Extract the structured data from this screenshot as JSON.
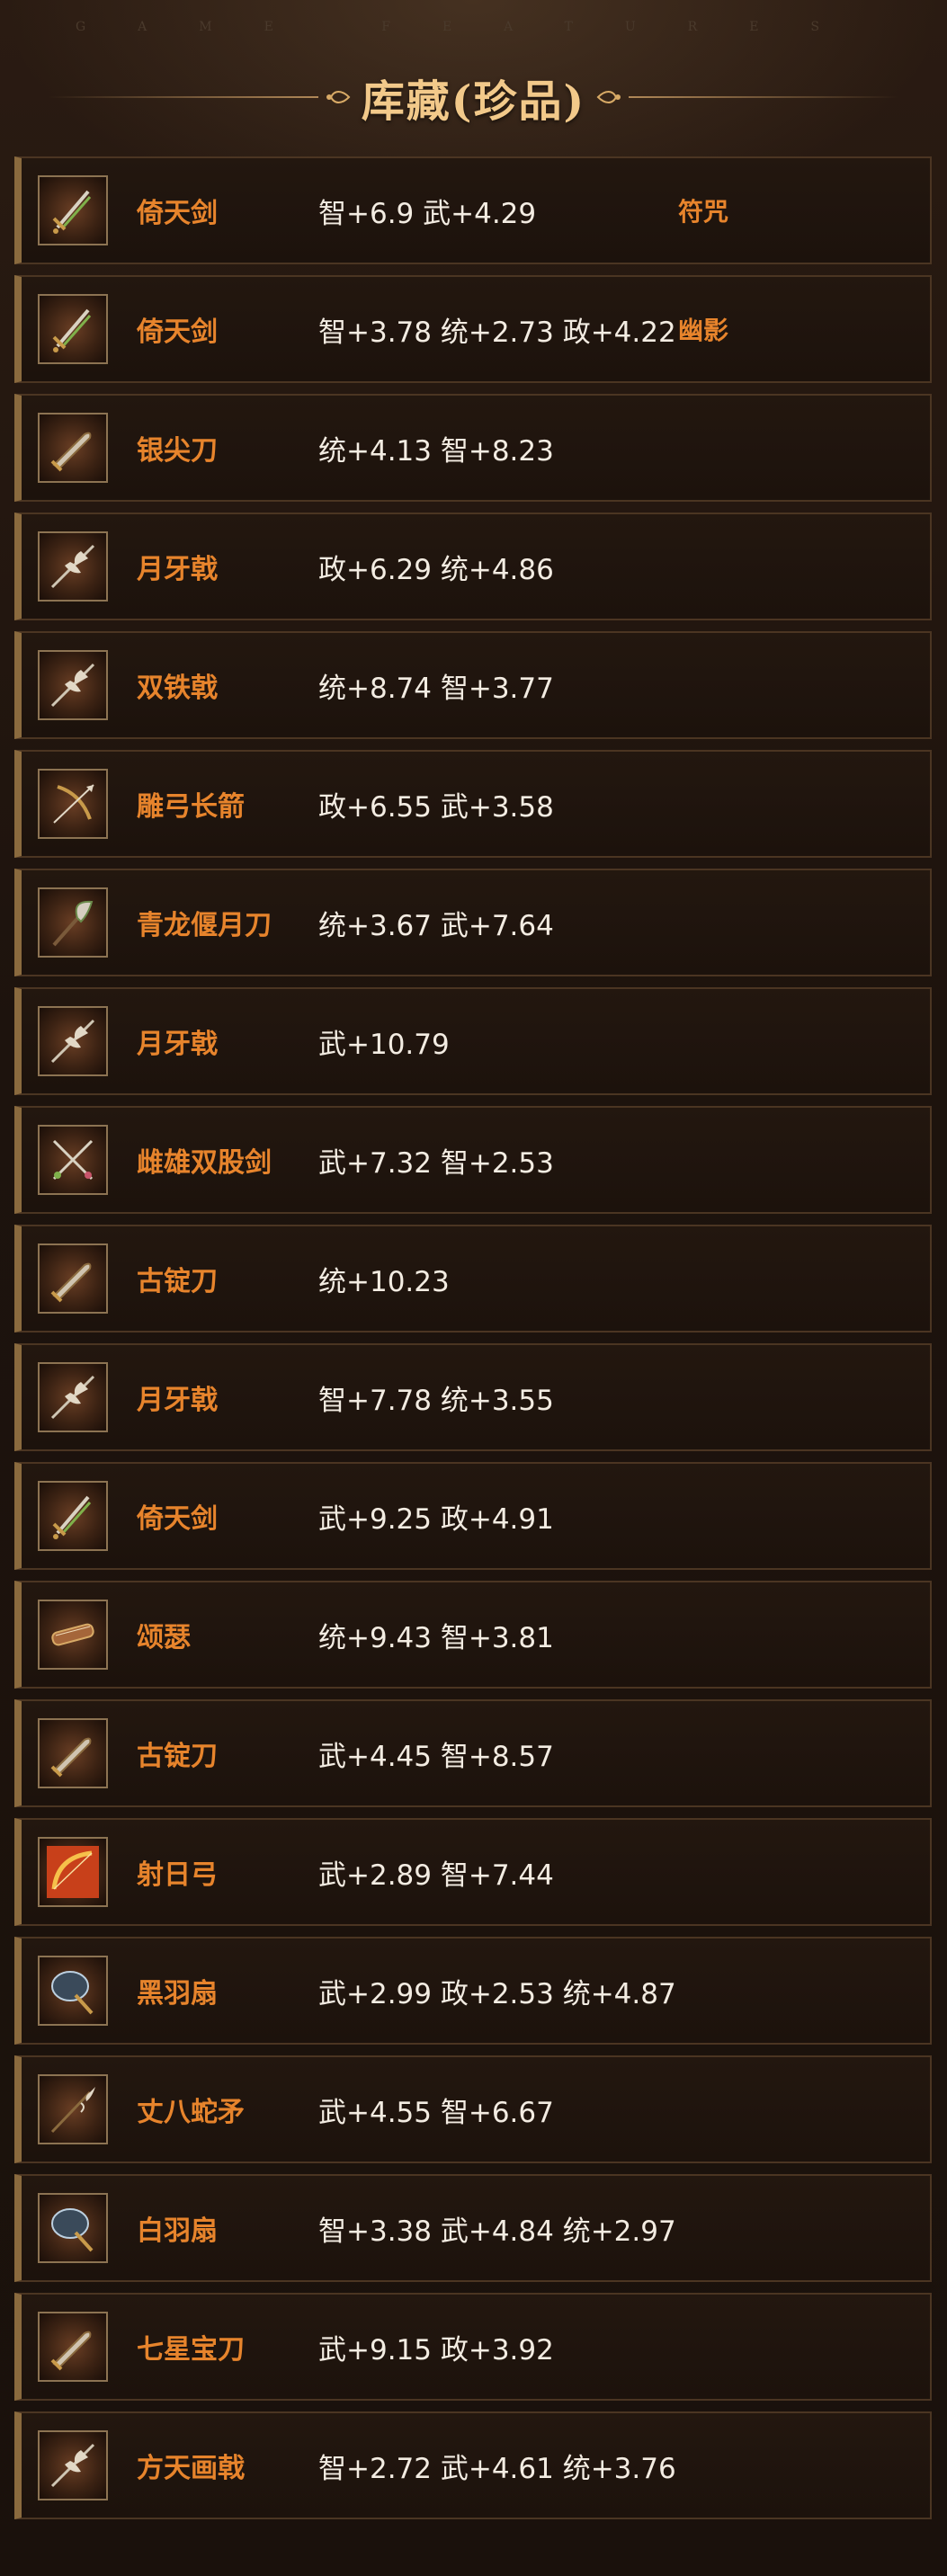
{
  "header": {
    "features_text": "GAME FEATURES",
    "title": "库藏(珍品)"
  },
  "items": [
    {
      "name": "倚天剑",
      "stats": "智+6.9 武+4.29",
      "tag": "符咒",
      "icon": "sword-icon"
    },
    {
      "name": "倚天剑",
      "stats": "智+3.78 统+2.73 政+4.22",
      "tag": "幽影",
      "icon": "sword-icon"
    },
    {
      "name": "银尖刀",
      "stats": "统+4.13 智+8.23",
      "tag": "",
      "icon": "blade-icon"
    },
    {
      "name": "月牙戟",
      "stats": "政+6.29 统+4.86",
      "tag": "",
      "icon": "halberd-icon"
    },
    {
      "name": "双铁戟",
      "stats": "统+8.74 智+3.77",
      "tag": "",
      "icon": "halberd-icon"
    },
    {
      "name": "雕弓长箭",
      "stats": "政+6.55 武+3.58",
      "tag": "",
      "icon": "bow-arrow-icon"
    },
    {
      "name": "青龙偃月刀",
      "stats": "统+3.67 武+7.64",
      "tag": "",
      "icon": "glaive-icon"
    },
    {
      "name": "月牙戟",
      "stats": "武+10.79",
      "tag": "",
      "icon": "halberd-icon"
    },
    {
      "name": "雌雄双股剑",
      "stats": "武+7.32 智+2.53",
      "tag": "",
      "icon": "twin-swords-icon"
    },
    {
      "name": "古锭刀",
      "stats": "统+10.23",
      "tag": "",
      "icon": "blade-icon"
    },
    {
      "name": "月牙戟",
      "stats": "智+7.78 统+3.55",
      "tag": "",
      "icon": "halberd-icon"
    },
    {
      "name": "倚天剑",
      "stats": "武+9.25 政+4.91",
      "tag": "",
      "icon": "sword-icon"
    },
    {
      "name": "颂瑟",
      "stats": "统+9.43 智+3.81",
      "tag": "",
      "icon": "zither-icon"
    },
    {
      "name": "古锭刀",
      "stats": "武+4.45 智+8.57",
      "tag": "",
      "icon": "blade-icon"
    },
    {
      "name": "射日弓",
      "stats": "武+2.89 智+7.44",
      "tag": "",
      "icon": "bow-icon"
    },
    {
      "name": "黑羽扇",
      "stats": "武+2.99 政+2.53 统+4.87",
      "tag": "",
      "icon": "feather-fan-icon"
    },
    {
      "name": "丈八蛇矛",
      "stats": "武+4.55 智+6.67",
      "tag": "",
      "icon": "spear-icon"
    },
    {
      "name": "白羽扇",
      "stats": "智+3.38 武+4.84 统+2.97",
      "tag": "",
      "icon": "feather-fan-icon"
    },
    {
      "name": "七星宝刀",
      "stats": "武+9.15 政+3.92",
      "tag": "",
      "icon": "blade-icon"
    },
    {
      "name": "方天画戟",
      "stats": "智+2.72 武+4.61 统+3.76",
      "tag": "",
      "icon": "halberd-icon"
    }
  ],
  "colors": {
    "name": "#e7842c",
    "stats": "#f3ece2",
    "title": "#f2c98a",
    "row_border": "#4b3522",
    "row_accent": "#8a6a3e"
  }
}
